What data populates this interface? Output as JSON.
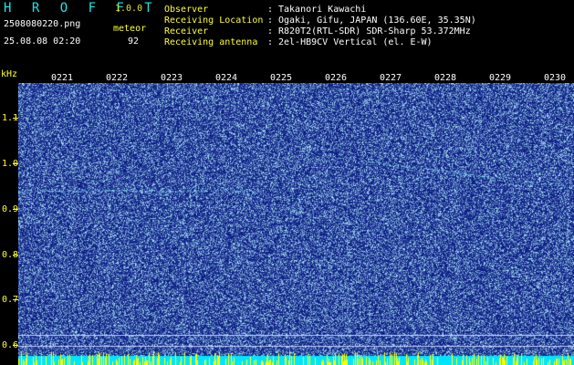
{
  "header": {
    "app_title": "H R O F F T",
    "app_version": "1.0.0",
    "filename": "2508080220.png",
    "detection_label": "meteor",
    "datetime": "25.08.08 02:20",
    "meteor_count": "92"
  },
  "station": {
    "fields": [
      {
        "label": "Observer",
        "value": "Takanori Kawachi"
      },
      {
        "label": "Receiving Location",
        "value": "Ogaki, Gifu, JAPAN (136.60E, 35.35N)"
      },
      {
        "label": "Receiver",
        "value": "R820T2(RTL-SDR) SDR-Sharp 53.372MHz"
      },
      {
        "label": "Receiving antenna",
        "value": "2el-HB9CV Vertical (el. E-W)"
      }
    ],
    "separator": ":"
  },
  "axis": {
    "unit": "kHz",
    "freq_labels": [
      "1.1",
      "1.0",
      "0.9",
      "0.8",
      "0.7",
      "0.6"
    ],
    "freq_values": [
      1.1,
      1.0,
      0.9,
      0.8,
      0.7,
      0.6
    ],
    "time_labels": [
      "0221",
      "0222",
      "0223",
      "0224",
      "0225",
      "0226",
      "0227",
      "0228",
      "0229",
      "0230"
    ]
  },
  "colors": {
    "background": "#000000",
    "spectrum_base": "#0a1a8c",
    "title": "#19e6e6",
    "label": "#ffff30",
    "value": "#ffffff",
    "meteor_trace": "#7ee8ff",
    "baseline_cyan": "#00e5ff",
    "baseline_yellow": "#ffff00"
  }
}
